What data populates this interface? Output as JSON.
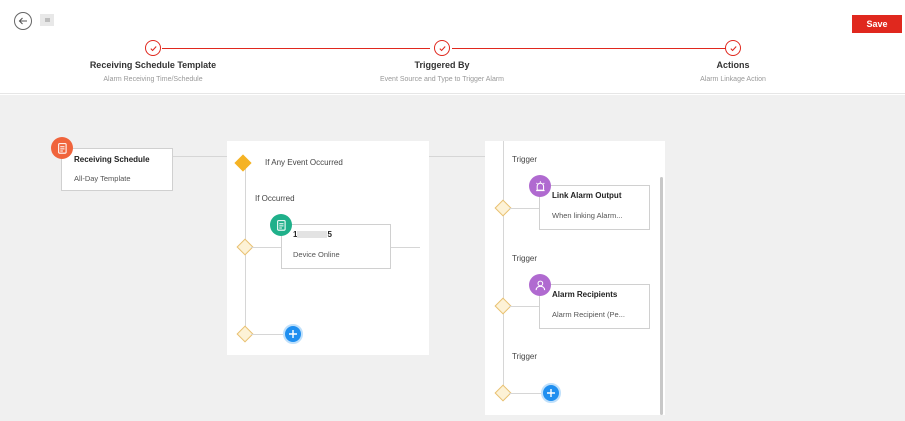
{
  "header": {
    "save_label": "Save"
  },
  "steps": [
    {
      "title": "Receiving Schedule Template",
      "subtitle": "Alarm Receiving Time/Schedule"
    },
    {
      "title": "Triggered By",
      "subtitle": "Event Source and Type to Trigger Alarm"
    },
    {
      "title": "Actions",
      "subtitle": "Alarm Linkage Action"
    }
  ],
  "schedule_node": {
    "title": "Receiving Schedule",
    "value": "All-Day Template"
  },
  "trigger_panel": {
    "condition_label": "If Any Event Occurred",
    "occurred_label": "If Occurred",
    "source_name_prefix": "1",
    "source_name_suffix": "5",
    "source_event": "Device Online"
  },
  "actions_panel": {
    "trigger_label": "Trigger",
    "actions": [
      {
        "title": "Link Alarm Output",
        "value": "When linking Alarm..."
      },
      {
        "title": "Alarm Recipients",
        "value": "Alarm Recipient (Pe..."
      }
    ]
  },
  "colors": {
    "accent": "#e0281e",
    "schedule_icon": "#f0643c",
    "source_icon": "#1fb08a",
    "action_icon": "#b06ad0",
    "add_button": "#1f8ff0",
    "condition_diamond": "#f5b324"
  },
  "icons": {
    "back": "back-arrow-icon",
    "step_done": "check-icon",
    "schedule": "document-icon",
    "source": "document-icon",
    "condition": "branch-icon",
    "alarm_output": "alarm-output-icon",
    "recipients": "user-icon",
    "add": "plus-icon"
  }
}
